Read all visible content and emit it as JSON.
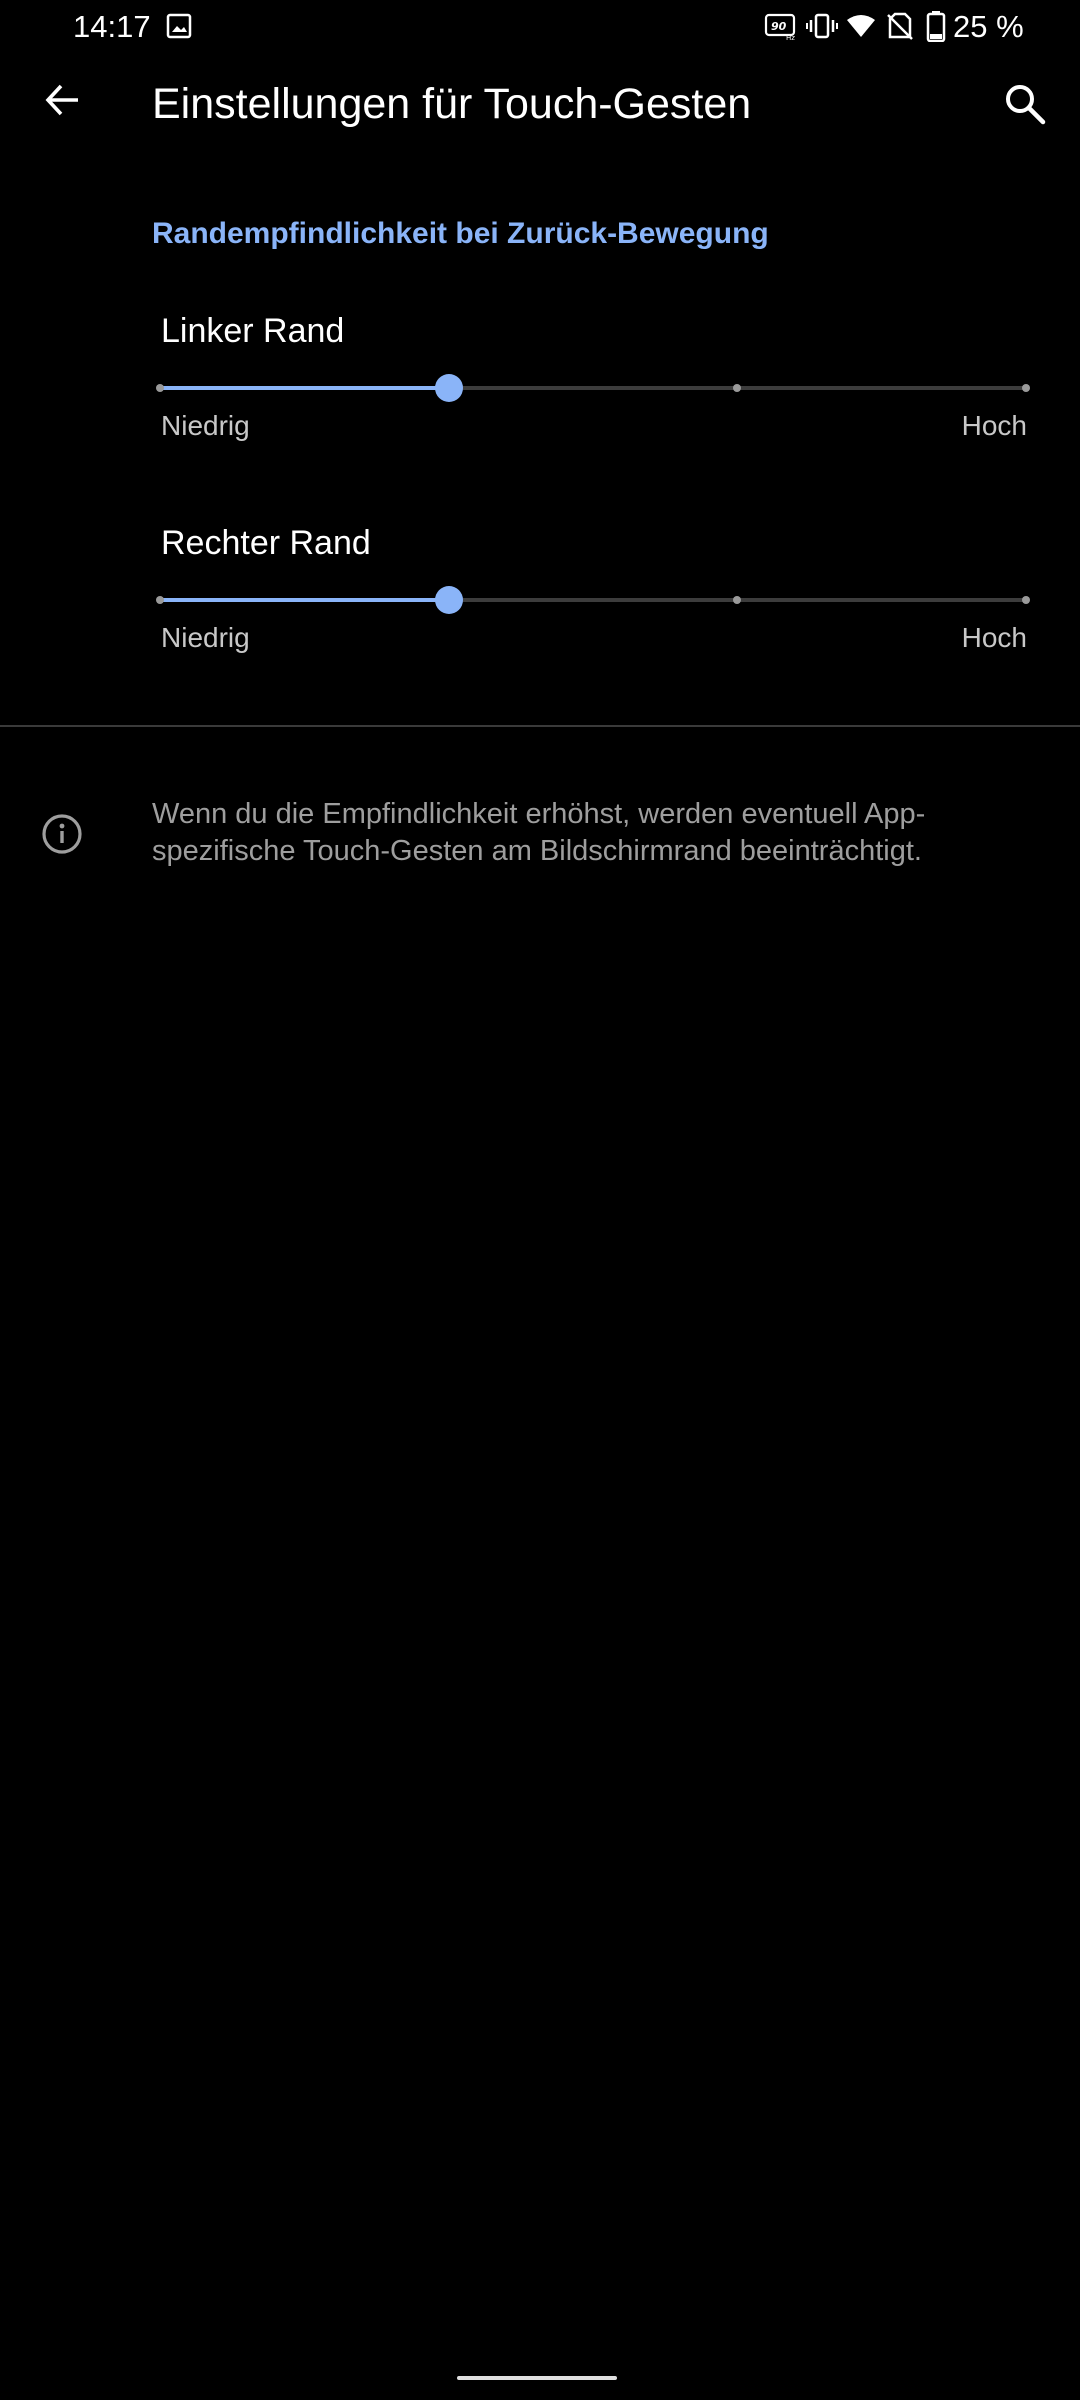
{
  "status_bar": {
    "time": "14:17",
    "battery": "25 %",
    "icons": [
      "gallery-icon",
      "refresh-rate-90hz-icon",
      "vibrate-icon",
      "wifi-icon",
      "no-sim-icon",
      "battery-icon"
    ]
  },
  "app_bar": {
    "title": "Einstellungen für Touch-Gesten",
    "back_icon": "arrow-back-icon",
    "search_icon": "search-icon"
  },
  "section": {
    "header": "Randempfindlichkeit bei Zurück-Bewegung"
  },
  "sliders": [
    {
      "title": "Linker Rand",
      "min_label": "Niedrig",
      "max_label": "Hoch",
      "steps": 4,
      "value_index": 1
    },
    {
      "title": "Rechter Rand",
      "min_label": "Niedrig",
      "max_label": "Hoch",
      "steps": 4,
      "value_index": 1
    }
  ],
  "footer": {
    "info_icon": "info-icon",
    "text": "Wenn du die Empfindlichkeit erhöhst, werden eventuell App-spezifische Touch-Gesten am Bildschirmrand beeinträchtigt."
  },
  "colors": {
    "background": "#000000",
    "accent": "#8ab4f8",
    "secondary_text": "#9e9e9e"
  }
}
